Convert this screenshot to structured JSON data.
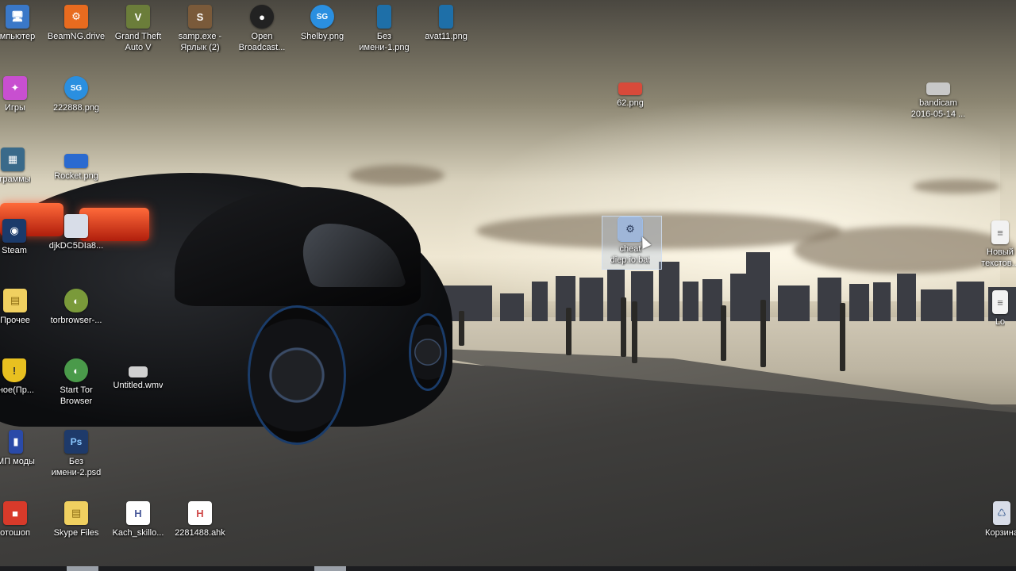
{
  "desktop": {
    "icons": [
      {
        "label": "мпьютер",
        "icon": "computer-icon",
        "color": "#3a78c8"
      },
      {
        "label": "BeamNG.drive",
        "icon": "beamng-icon",
        "color": "#e86b1f"
      },
      {
        "label": "Grand Theft\nAuto V",
        "icon": "gta-icon",
        "color": "#6b7d3a"
      },
      {
        "label": "samp.exe -\nЯрлык (2)",
        "icon": "samp-icon",
        "color": "#7a5a3a"
      },
      {
        "label": "Open\nBroadcast...",
        "icon": "obs-icon",
        "color": "#222222"
      },
      {
        "label": "Shelby.png",
        "icon": "image-icon",
        "color": "#2a8fe0"
      },
      {
        "label": "Без\nимени-1.png",
        "icon": "image-icon",
        "color": "#1e6fa8"
      },
      {
        "label": "avat11.png",
        "icon": "image-icon",
        "color": "#1e6fa8"
      },
      {
        "label": "Игры",
        "icon": "games-icon",
        "color": "#c84fd0"
      },
      {
        "label": "222888.png",
        "icon": "image-icon",
        "color": "#2a8fe0"
      },
      {
        "label": "62.png",
        "icon": "image-icon",
        "color": "#d84a3a"
      },
      {
        "label": "bandicam\n2016-05-14 ...",
        "icon": "video-icon",
        "color": "#c8c8c8"
      },
      {
        "label": "ограммы",
        "icon": "programs-icon",
        "color": "#3a6a8a"
      },
      {
        "label": "Rocket.png",
        "icon": "image-icon",
        "color": "#2a6ad0"
      },
      {
        "label": "Steam",
        "icon": "steam-icon",
        "color": "#1b3a6a"
      },
      {
        "label": "djkDC5DIa8...",
        "icon": "image-icon",
        "color": "#d8dde8"
      },
      {
        "label": "cheat\ndiep.io.bat",
        "icon": "batch-file-icon",
        "color": "#9fb6d8"
      },
      {
        "label": "Новый\nтекстов...",
        "icon": "text-file-icon",
        "color": "#f2f2f2"
      },
      {
        "label": "Прочее",
        "icon": "folder-icon",
        "color": "#f0d060"
      },
      {
        "label": "torbrowser-...",
        "icon": "tor-icon",
        "color": "#7a9a3a"
      },
      {
        "label": "Start Tor\nBrowser",
        "icon": "tor-browser-icon",
        "color": "#4a9a4a"
      },
      {
        "label": "Untitled.wmv",
        "icon": "video-icon",
        "color": "#d0d0d0"
      },
      {
        "label": "кное(Пр...",
        "icon": "shield-icon",
        "color": "#e8c020"
      },
      {
        "label": "МП моды",
        "icon": "mods-icon",
        "color": "#2a4aa8"
      },
      {
        "label": "Без\nимени-2.psd",
        "icon": "photoshop-icon",
        "color": "#1e3a6a"
      },
      {
        "label": "отошоп",
        "icon": "photoshop-app-icon",
        "color": "#d83a2a"
      },
      {
        "label": "Skype Files",
        "icon": "folder-icon",
        "color": "#f0d060"
      },
      {
        "label": "Kach_skillo...",
        "icon": "ahk-icon",
        "color": "#4a5a9a"
      },
      {
        "label": "2281488.ahk",
        "icon": "ahk-icon",
        "color": "#d04a4a"
      },
      {
        "label": "Корзина",
        "icon": "recycle-bin-icon",
        "color": "#d8dde8"
      },
      {
        "label": "Lo",
        "icon": "text-file-icon",
        "color": "#f2f2f2"
      }
    ]
  },
  "glyphs": {
    "computer": "🖥",
    "beamng": "⚙",
    "gta": "V",
    "samp": "S",
    "obs": "●",
    "image": "SG",
    "folder": "▤",
    "steam": "◉",
    "tor": "◐",
    "shield": "!",
    "psd": "Ps",
    "ahk": "H",
    "recycle": "♺",
    "text": "≡",
    "bat": "⚙",
    "video": "▭",
    "games": "✦",
    "programs": "▦",
    "mods": "▮",
    "photoshop": "■"
  }
}
